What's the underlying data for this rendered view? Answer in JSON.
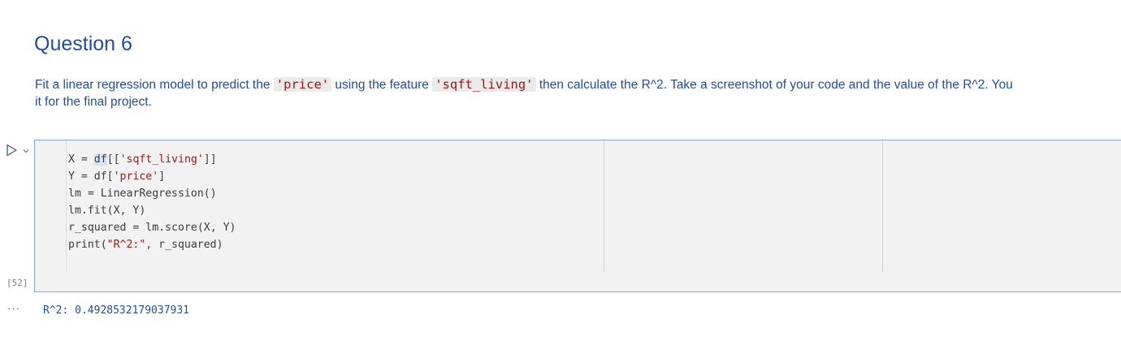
{
  "markdown": {
    "heading": "Question 6",
    "para": {
      "t1": "Fit a linear regression model to predict the ",
      "code1": "'price'",
      "t2": " using the feature ",
      "code2": "'sqft_living'",
      "t3": " then calculate the R^2. Take a screenshot of your code and the value of the R^2. You",
      "line2": "it for the final project."
    }
  },
  "cell": {
    "execution_count": "[52]",
    "run_icon": "play-icon",
    "menu_icon": "chevron-down-icon",
    "code": {
      "l1": {
        "a": "X ",
        "b": "=",
        "c": " ",
        "d": "df",
        "e": "[[",
        "f": "'sqft_living'",
        "g": "]]"
      },
      "l2": {
        "a": "Y ",
        "b": "=",
        "c": " df[",
        "d": "'price'",
        "e": "]"
      },
      "l3": {
        "a": "lm ",
        "b": "=",
        "c": " LinearRegression()"
      },
      "l4": {
        "a": "lm.fit(X, Y)"
      },
      "l5": {
        "a": "r_squared ",
        "b": "=",
        "c": " lm.score(X, Y)"
      },
      "l6": {
        "a": "print(",
        "b": "\"R^2:\"",
        "c": ", r_squared)"
      }
    }
  },
  "output": {
    "more_label": "···",
    "text": "R^2: 0.4928532179037931"
  },
  "colors": {
    "markdown_text": "#1f4f9a",
    "string": "#a31515",
    "cell_border": "#86aad8",
    "cell_background": "#f2f2f2"
  }
}
